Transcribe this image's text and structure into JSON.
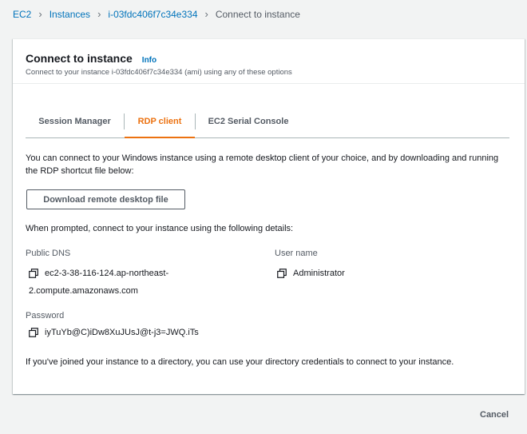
{
  "breadcrumb": {
    "items": [
      "EC2",
      "Instances",
      "i-03fdc406f7c34e334"
    ],
    "current": "Connect to instance"
  },
  "panel": {
    "title": "Connect to instance",
    "info_label": "Info",
    "subtitle": "Connect to your instance i-03fdc406f7c34e334 (ami) using any of these options"
  },
  "tabs": [
    {
      "label": "Session Manager",
      "active": false
    },
    {
      "label": "RDP client",
      "active": true
    },
    {
      "label": "EC2 Serial Console",
      "active": false
    }
  ],
  "rdp": {
    "intro": "You can connect to your Windows instance using a remote desktop client of your choice, and by downloading and running the RDP shortcut file below:",
    "download_button": "Download remote desktop file",
    "prompt": "When prompted, connect to your instance using the following details:",
    "public_dns_label": "Public DNS",
    "public_dns_line1": "ec2-3-38-116-124.ap-northeast-",
    "public_dns_line2": "2.compute.amazonaws.com",
    "username_label": "User name",
    "username_value": "Administrator",
    "password_label": "Password",
    "password_value": "iyTuYb@C)iDw8XuJUsJ@t-j3=JWQ.iTs",
    "directory_note": "If you've joined your instance to a directory, you can use your directory credentials to connect to your instance."
  },
  "footer": {
    "cancel_label": "Cancel"
  },
  "colors": {
    "link": "#0073bb",
    "accent": "#ec7211",
    "text": "#16191f",
    "muted": "#545b64"
  },
  "icons": {
    "copy": "copy-icon",
    "breadcrumb_separator": "chevron-right-icon"
  }
}
